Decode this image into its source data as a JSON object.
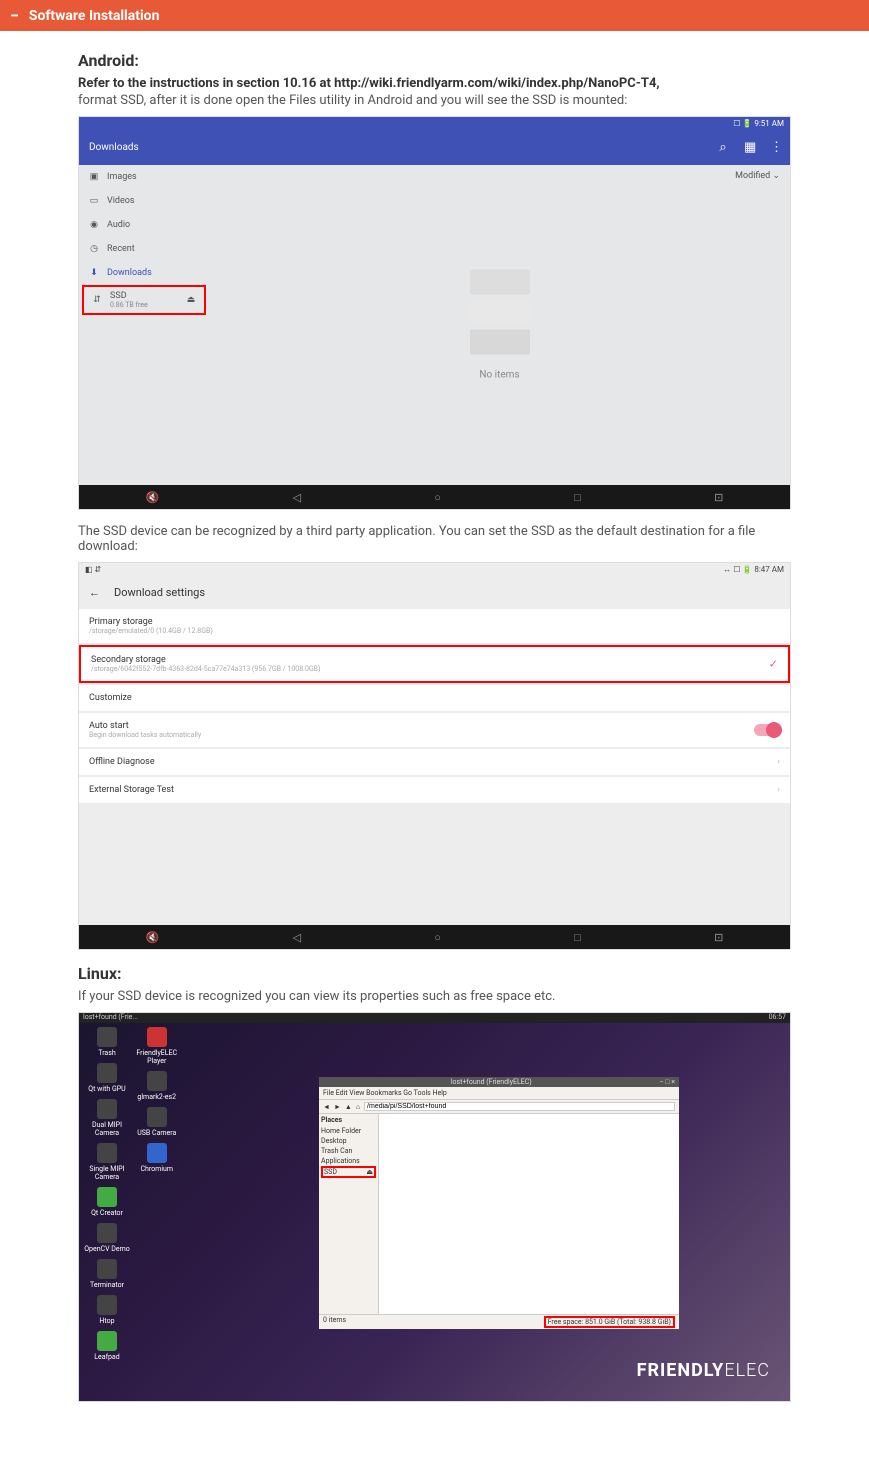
{
  "header": {
    "title": "Software Installation"
  },
  "android": {
    "heading": "Android:",
    "line1": "Refer to the instructions  in section 10.16 at http://wiki.friendlyarm.com/wiki/index.php/NanoPC-T4,",
    "line2": "format SSD, after it is done open the Files utility in Android and you will see the SSD is mounted:",
    "after1": "The SSD device can be recognized by a third party application. You can set the SSD as the default destination for a file download:"
  },
  "linux": {
    "heading": "Linux:",
    "line1": "If your SSD device is recognized you can view its properties such as free space etc."
  },
  "s1": {
    "status_time": "9:51 AM",
    "title": "Downloads",
    "modified": "Modified",
    "items": {
      "images": "Images",
      "videos": "Videos",
      "audio": "Audio",
      "recent": "Recent",
      "downloads": "Downloads"
    },
    "ssd": {
      "name": "SSD",
      "free": "0.86 TB free"
    },
    "empty": "No items"
  },
  "s2": {
    "status_time": "8:47 AM",
    "title": "Download settings",
    "primary": {
      "label": "Primary storage",
      "sub": "/storage/emulated/0 (10.4GB / 12.8GB)"
    },
    "secondary": {
      "label": "Secondary storage",
      "sub": "/storage/6042f552-7dfb-4363-82d4-5ca77e74a313 (956.7GB / 1008.0GB)"
    },
    "customize": "Customize",
    "autostart": {
      "label": "Auto start",
      "sub": "Begin download tasks automatically"
    },
    "offline": "Offline Diagnose",
    "external": "External Storage Test"
  },
  "s3": {
    "task_left": "lost+found (Frie...",
    "task_right": "06:57",
    "icons_col1": [
      "Trash",
      "Qt with GPU",
      "Dual MIPI Camera",
      "Single MIPI Camera",
      "Qt Creator",
      "OpenCV Demo",
      "Terminator",
      "Htop",
      "Leafpad"
    ],
    "icons_col2": [
      "FriendlyELEC Player",
      "glmark2-es2",
      "USB Camera",
      "Chromium"
    ],
    "win": {
      "title": "lost+found (FriendlyELEC)",
      "menu": "File  Edit  View  Bookmarks  Go  Tools  Help",
      "path": "/media/pi/SSD/lost+found",
      "places": "Places",
      "side": [
        "Home Folder",
        "Desktop",
        "Trash Can",
        "Applications"
      ],
      "ssd": "SSD",
      "status_left": "0 items",
      "status_right": "Free space: 851.0 GiB (Total: 938.8 GiB)"
    },
    "brand1": "FRIENDLY",
    "brand2": "ELEC"
  }
}
